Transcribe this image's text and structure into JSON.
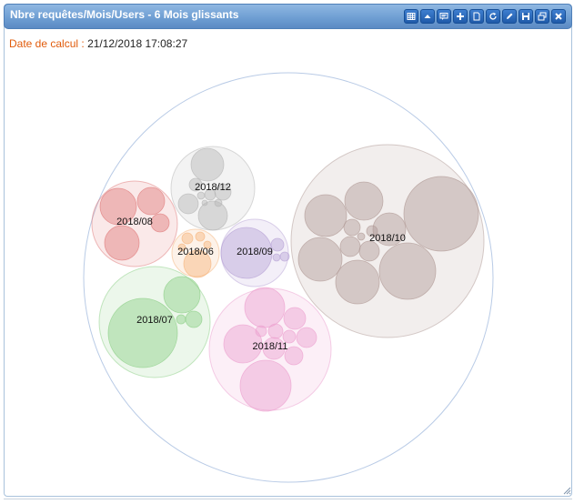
{
  "window": {
    "title": "Nbre requêtes/Mois/Users - 6 Mois glissants",
    "toolbar_icons": [
      "table-icon",
      "collapse-up-icon",
      "comment-icon",
      "add-icon",
      "document-icon",
      "refresh-icon",
      "edit-icon",
      "save-icon",
      "restore-icon",
      "close-icon"
    ]
  },
  "calc": {
    "label": "Date de calcul :",
    "value": "21/12/2018 17:08:27"
  },
  "chart_data": {
    "type": "bubble-pack",
    "groups": [
      {
        "name": "2018/12",
        "color": "#b5b5b5",
        "children": [
          5,
          4,
          3,
          3,
          2.5,
          2,
          0.8,
          0.8,
          0.6
        ]
      },
      {
        "name": "2018/08",
        "color": "#e07a7a",
        "children": [
          5,
          4,
          3,
          2
        ]
      },
      {
        "name": "2018/06",
        "color": "#f6b37a",
        "children": [
          6,
          1.5,
          1,
          1,
          0.8
        ]
      },
      {
        "name": "2018/09",
        "color": "#b7a3d6",
        "children": [
          10,
          1,
          0.6,
          0.6
        ]
      },
      {
        "name": "2018/10",
        "color": "#b09a96",
        "children": [
          30,
          20,
          20,
          12,
          12,
          10,
          8,
          3,
          2,
          2,
          1
        ]
      },
      {
        "name": "2018/07",
        "color": "#8ccf86",
        "children": [
          42,
          10,
          2,
          1
        ]
      },
      {
        "name": "2018/11",
        "color": "#ec9fcf",
        "children": [
          20,
          12,
          12,
          4,
          4,
          4,
          3,
          2,
          1.5
        ]
      }
    ],
    "colors": {
      "outer": "#b9cbe6",
      "2018/12": "#b5b5b5",
      "2018/08": "#e07a7a",
      "2018/06": "#f6b37a",
      "2018/09": "#b7a3d6",
      "2018/10": "#b09a96",
      "2018/07": "#8ccf86",
      "2018/11": "#ec9fcf"
    }
  }
}
